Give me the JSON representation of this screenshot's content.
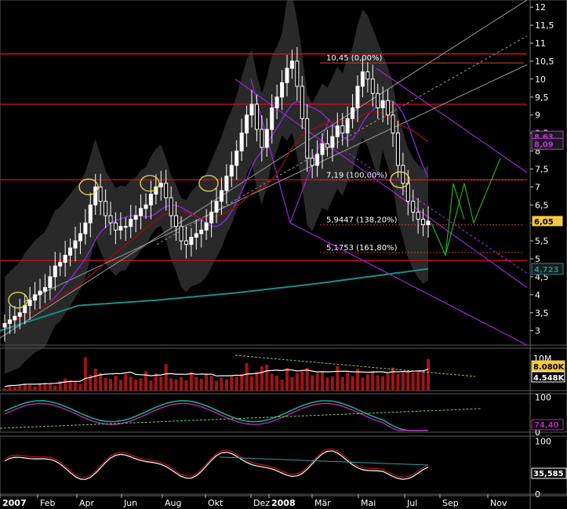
{
  "colors": {
    "background": "#000000",
    "grid": "#9a9a9a",
    "candle_up": "#ffffff",
    "candle_down": "#ffffff",
    "resistance": "#c8101a",
    "fib_dotted": "#d23a3a",
    "pitchfork": "#9c27d8",
    "bollinger_fill": "#4a4a4a",
    "ma_dark_red": "#8a1010",
    "ma_teal": "#1e8c8c",
    "ma_violet": "#8a2be2",
    "forecast": "#1fb01f",
    "highlight_circle": "#e6e04a",
    "volume_bar": "#a01418",
    "volume_avg": "#ffffff",
    "volume_trend": "#7ad05a",
    "badge_yellow": "#f5c840"
  },
  "chart_data": [
    {
      "type": "candlestick",
      "panel": "price",
      "x_axis": {
        "labels": [
          "2007",
          "Feb",
          "Apr",
          "Jun",
          "Aug",
          "Okt",
          "Dez",
          "2008",
          "Mär",
          "Mai",
          "Jul",
          "Sep",
          "Nov"
        ],
        "bold": [
          "2007",
          "2008"
        ]
      },
      "y_axis": {
        "side": "right",
        "ylim": [
          2.6,
          12.2
        ],
        "ticks": [
          "12",
          "11,5",
          "11",
          "10,5",
          "10",
          "9,5",
          "9",
          "8,5",
          "8",
          "7,5",
          "7",
          "6,5",
          "6",
          "5,5",
          "5",
          "4,5",
          "4",
          "3,5",
          "3"
        ]
      },
      "weekly_close": [
        3.2,
        3.3,
        3.4,
        3.5,
        3.7,
        3.85,
        4.0,
        4.1,
        4.2,
        4.5,
        4.8,
        4.9,
        5.1,
        5.3,
        5.5,
        5.7,
        6.0,
        6.5,
        7.0,
        6.6,
        6.2,
        6.0,
        5.8,
        5.9,
        5.9,
        6.1,
        6.2,
        6.4,
        6.5,
        6.8,
        7.0,
        7.1,
        6.7,
        6.2,
        5.9,
        5.5,
        5.4,
        5.6,
        5.7,
        5.8,
        6.0,
        6.3,
        6.6,
        6.9,
        7.3,
        7.6,
        8.0,
        8.5,
        9.0,
        9.3,
        8.6,
        8.1,
        8.6,
        9.2,
        9.5,
        9.9,
        10.3,
        10.5,
        9.8,
        8.9,
        7.8,
        7.6,
        7.9,
        8.2,
        8.1,
        8.4,
        8.7,
        8.5,
        8.9,
        9.2,
        9.8,
        10.2,
        10.0,
        9.6,
        9.2,
        9.4,
        9.0,
        8.5,
        7.6,
        7.1,
        6.6,
        6.3,
        6.1,
        5.95,
        6.05
      ],
      "resistance_levels": [
        10.7,
        9.3,
        7.2,
        4.95
      ],
      "fib_levels": [
        {
          "value": 10.45,
          "label": "10,45 (0,00%)"
        },
        {
          "value": 7.19,
          "label": "7,19 (100,00%)"
        },
        {
          "value": 5.9447,
          "label": "5,9447 (138,20%)"
        },
        {
          "value": 5.1753,
          "label": "5,1753 (161,80%)"
        }
      ],
      "forecast_path": [
        6.0,
        5.1,
        7.1,
        6.0,
        7.8
      ],
      "highlight_circles": 5
    },
    {
      "type": "bar",
      "panel": "volume",
      "y_axis": {
        "ticks": [
          "10M"
        ]
      },
      "values_k": [
        600,
        1200,
        900,
        1500,
        1800,
        1400,
        1100,
        1700,
        2000,
        1600,
        1300,
        2500,
        3100,
        2600,
        2200,
        1700,
        8500,
        4000,
        5600,
        4500,
        3200,
        3000,
        3800,
        2700,
        4200,
        3500,
        2800,
        3100,
        5000,
        2600,
        4400,
        3600,
        6800,
        3100,
        2900,
        3400,
        2600,
        4700,
        3500,
        3000,
        4100,
        3700,
        2500,
        3300,
        2900,
        3900,
        3500,
        4200,
        7000,
        3700,
        4900,
        6200,
        6600,
        4300,
        3800,
        2800,
        5800,
        3400,
        4500,
        4900,
        5800,
        3900,
        4500,
        4800,
        3300,
        3600,
        6300,
        3500,
        4600,
        3700,
        5600,
        3300,
        4200,
        5000,
        3900,
        3700,
        4400,
        5900,
        4200,
        4600,
        4900,
        4700,
        5000,
        5100,
        8080
      ],
      "badges": [
        "8.080K",
        "4.548K"
      ]
    },
    {
      "type": "line",
      "panel": "oscillator",
      "y_axis": {
        "ticks": [
          "100",
          "0"
        ]
      },
      "badge": "74,40"
    },
    {
      "type": "line",
      "panel": "momentum",
      "y_axis": {
        "ticks": [
          "100",
          "0"
        ]
      },
      "badge": "35,585"
    }
  ],
  "price_badges": [
    {
      "label": "6,05",
      "value": 6.05,
      "kind": "last"
    },
    {
      "label": "8,63",
      "value": 8.4,
      "kind": "ma"
    },
    {
      "label": "8,09",
      "value": 8.2,
      "kind": "ma"
    },
    {
      "label": "4,723",
      "value": 4.72,
      "kind": "ma"
    }
  ]
}
